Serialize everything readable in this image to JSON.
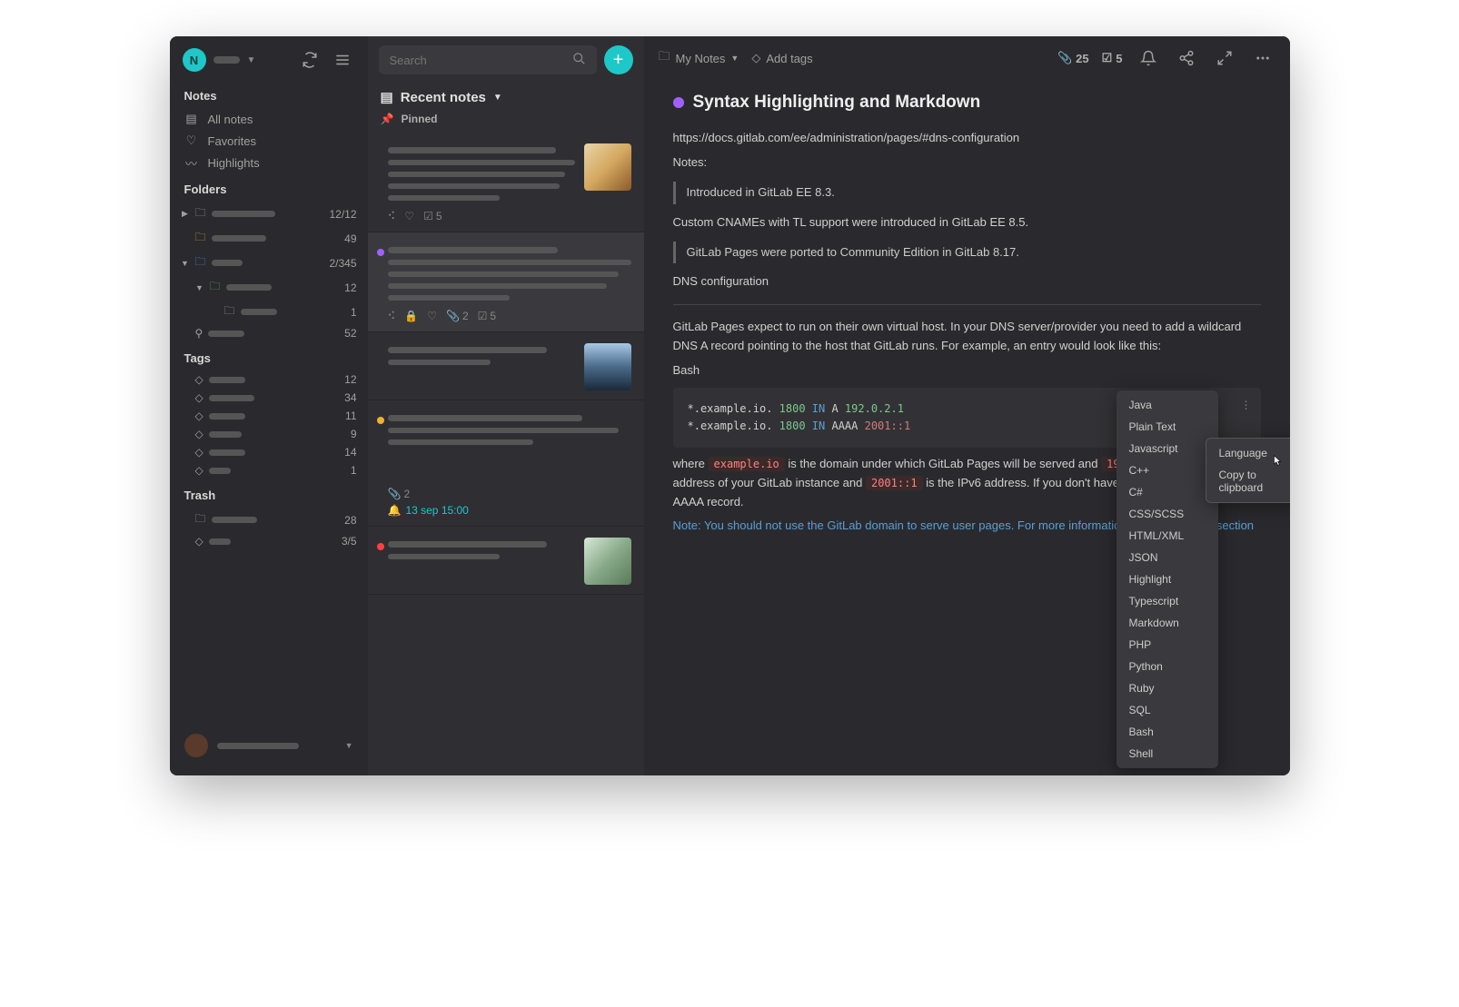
{
  "sidebar": {
    "notes_section": "Notes",
    "all_notes": "All notes",
    "favorites": "Favorites",
    "highlights": "Highlights",
    "folders_section": "Folders",
    "folder_counts": [
      "12/12",
      "49",
      "2/345",
      "12",
      "1",
      "52"
    ],
    "tags_section": "Tags",
    "tag_counts": [
      "12",
      "34",
      "11",
      "9",
      "14",
      "1"
    ],
    "trash_section": "Trash",
    "trash_counts": [
      "28",
      "3/5"
    ]
  },
  "search": {
    "placeholder": "Search"
  },
  "list": {
    "title": "Recent notes",
    "pinned": "Pinned",
    "cards": [
      {
        "thumb": "cookies",
        "meta_count": "5"
      },
      {
        "dot": "#a060ff",
        "selected": true,
        "meta_attach": "2",
        "meta_count": "5"
      },
      {},
      {
        "dot": "#f0b030",
        "attach": "2",
        "reminder": "13 sep 15:00"
      },
      {
        "dot": "#ff4040",
        "thumb": "table"
      }
    ]
  },
  "toolbar": {
    "breadcrumb": "My Notes",
    "add_tags": "Add tags",
    "attach_count": "25",
    "todo_count": "5"
  },
  "note": {
    "title": "Syntax Highlighting and Markdown",
    "url": "https://docs.gitlab.com/ee/administration/pages/#dns-configuration",
    "notes_label": "Notes:",
    "quote1": "Introduced in GitLab EE 8.3.",
    "p_cnames": "Custom   CNAMEs with  TL support were introduced in GitLab EE 8.5.",
    "quote2": "GitLab Pages were ported to Community Edition in GitLab 8.17.",
    "dns_heading": "DNS configuration",
    "dns_para": "GitLab Pages expect to run  on  their own virtual host. In your DNS server/provider you need to add a wildcard DNS A record pointing to the host that GitLab runs. For example, an entry would look like this:",
    "bash_label": "Bash",
    "code_line1_a": "*.example.io. ",
    "code_line1_num": "1800",
    "code_line1_kw": " IN ",
    "code_line1_b": "A ",
    "code_line1_ip": "192.0.2.1",
    "code_line2_a": "*.example.io. ",
    "code_line2_num": "1800",
    "code_line2_kw": " IN ",
    "code_line2_b": "AAAA ",
    "code_line2_ip": "2001::1",
    "where_1": "where ",
    "where_code1": "example.io",
    "where_2": " is the domain under which GitLab Pages will be served and ",
    "where_code2": "192.0.2.1",
    "where_3": " is the IPv4 address of your GitLab instance and ",
    "where_code3": "2001::1",
    "where_4": " is the IPv6 address. If you don't have IPv6, you can omit the AAAA record.",
    "warn": "Note: You should not use the GitLab domain to serve user pages. For more information see the security section"
  },
  "context_lang": [
    "Java",
    "Plain Text",
    "Javascript",
    "C++",
    "C#",
    "CSS/SCSS",
    "HTML/XML",
    "JSON",
    "Highlight",
    "Typescript",
    "Markdown",
    "PHP",
    "Python",
    "Ruby",
    "SQL",
    "Bash",
    "Shell"
  ],
  "context_action": {
    "language": "Language",
    "copy": "Copy to clipboard"
  }
}
